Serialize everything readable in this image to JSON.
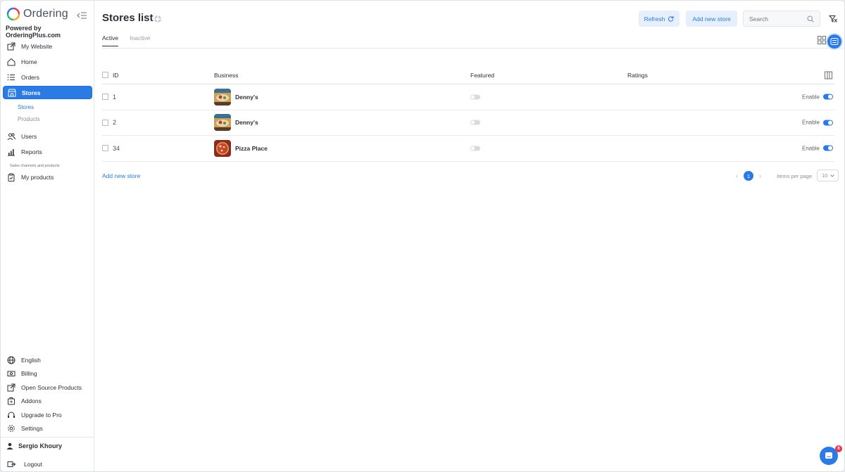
{
  "app": {
    "logo_text": "Ordering",
    "powered_by": "Powered by OrderingPlus.com"
  },
  "sidebar": {
    "items": [
      {
        "label": "My Website",
        "icon": "external-link-icon"
      },
      {
        "label": "Home",
        "icon": "home-icon"
      },
      {
        "label": "Orders",
        "icon": "list-icon"
      },
      {
        "label": "Stores",
        "icon": "store-icon",
        "active": true
      },
      {
        "label": "Users",
        "icon": "users-icon"
      },
      {
        "label": "Reports",
        "icon": "bar-chart-icon"
      }
    ],
    "sub_items": [
      {
        "label": "Stores",
        "active": true
      },
      {
        "label": "Products",
        "active": false
      }
    ],
    "section_label": "Sales channels and products",
    "my_products": "My products",
    "bottom_items": [
      {
        "label": "English",
        "icon": "globe-icon"
      },
      {
        "label": "Billing",
        "icon": "billing-icon"
      },
      {
        "label": "Open Source Products",
        "icon": "external-link-icon"
      },
      {
        "label": "Addons",
        "icon": "addons-icon"
      },
      {
        "label": "Upgrade to Pro",
        "icon": "headset-icon"
      },
      {
        "label": "Settings",
        "icon": "gear-icon"
      }
    ],
    "user_name": "Sergio Khoury",
    "logout": "Logout"
  },
  "header": {
    "title": "Stores list",
    "refresh_label": "Refresh",
    "add_store_label": "Add new store",
    "search_placeholder": "Search"
  },
  "tabs": [
    {
      "label": "Active",
      "active": true
    },
    {
      "label": "Inactive",
      "active": false
    }
  ],
  "table": {
    "columns": {
      "id": "ID",
      "business": "Business",
      "featured": "Featured",
      "ratings": "Ratings"
    },
    "rows": [
      {
        "id": "1",
        "name": "Denny's",
        "featured": false,
        "status_label": "Enable",
        "enabled": true
      },
      {
        "id": "2",
        "name": "Denny's",
        "featured": false,
        "status_label": "Enable",
        "enabled": true
      },
      {
        "id": "34",
        "name": "Pizza Place",
        "featured": false,
        "status_label": "Enable",
        "enabled": true
      }
    ]
  },
  "footer": {
    "add_link": "Add new store",
    "current_page": "1",
    "items_per_page_label": "Items per page",
    "items_per_page_value": "10"
  },
  "chat": {
    "badge_count": "6"
  },
  "colors": {
    "accent": "#2c7be5",
    "badge": "#e63757"
  }
}
